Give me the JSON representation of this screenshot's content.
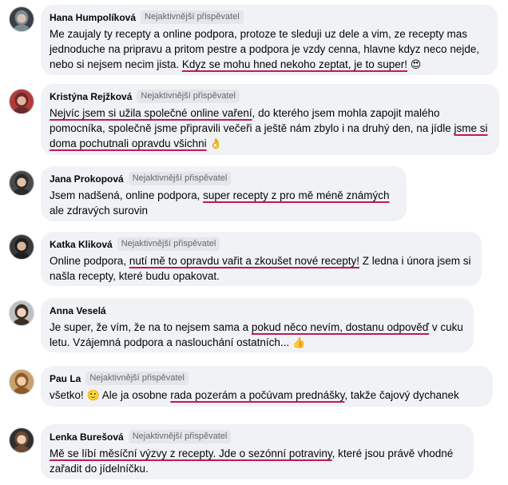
{
  "comments": [
    {
      "name": "Hana Humpolíková",
      "badge": "Nejaktivnější přispěvatel",
      "avatar_icon": "user-photo-avatar",
      "parts": [
        {
          "text": "Me zaujaly ty recepty a online podpora, protoze te sleduji uz dele a vim, ze recepty mas jednoduche na pripravu a pritom pestre a podpora je vzdy cenna, hlavne kdyz neco nejde, nebo si nejsem necim jista. "
        },
        {
          "text": "Kdyz se mohu hned nekoho zeptat, je to super!",
          "hl": true
        },
        {
          "text": " "
        },
        {
          "text": "😍",
          "emoji": true
        }
      ]
    },
    {
      "name": "Kristýna Rejžková",
      "badge": "Nejaktivnější přispěvatel",
      "avatar_icon": "user-photo-avatar",
      "parts": [
        {
          "text": "Nejvíc jsem si užila společné online vaření",
          "hl": true
        },
        {
          "text": ", do kterého jsem mohla zapojit malého pomocníka, společně jsme připravili večeři a ještě nám zbylo i na druhý den, na jídle "
        },
        {
          "text": "jsme si doma pochutnali opravdu všichni",
          "hl": true
        },
        {
          "text": " "
        },
        {
          "text": "👌",
          "emoji": true
        }
      ]
    },
    {
      "name": "Jana Prokopová",
      "badge": "Nejaktivnější přispěvatel",
      "avatar_icon": "user-photo-avatar",
      "parts": [
        {
          "text": "Jsem nadšená, online podpora, "
        },
        {
          "text": "super recepty z pro mě méně známých",
          "hl": true
        },
        {
          "text": " ale zdravých surovin"
        }
      ]
    },
    {
      "name": "Katka Kliková",
      "badge": "Nejaktivnější přispěvatel",
      "avatar_icon": "user-photo-avatar",
      "parts": [
        {
          "text": "Online podpora, "
        },
        {
          "text": "nutí mě to opravdu vařit a zkoušet nové recepty!",
          "hl": true
        },
        {
          "text": " Z ledna i února jsem si našla recepty, které budu opakovat."
        }
      ]
    },
    {
      "name": "Anna Veselá",
      "badge": "",
      "avatar_icon": "user-photo-avatar",
      "parts": [
        {
          "text": "Je super, že vím, že na to nejsem sama a "
        },
        {
          "text": "pokud něco nevím, dostanu odpověď",
          "hl": true
        },
        {
          "text": " v cuku letu. Vzájemná podpora a naslouchání ostatních... "
        },
        {
          "text": "👍",
          "emoji": true
        }
      ]
    },
    {
      "name": "Pau La",
      "badge": "Nejaktivnější přispěvatel",
      "avatar_icon": "user-photo-avatar",
      "parts": [
        {
          "text": "všetko! "
        },
        {
          "text": "🙂",
          "emoji": true
        },
        {
          "text": " Ale ja osobne "
        },
        {
          "text": "rada pozerám a počúvam prednášky",
          "hl": true
        },
        {
          "text": ", takže čajový dychanek"
        }
      ]
    },
    {
      "name": "Lenka Burešová",
      "badge": "Nejaktivnější přispěvatel",
      "avatar_icon": "user-photo-avatar",
      "parts": [
        {
          "text": "Mě se líbí měsíční výzvy z recepty. Jde o sezónní potraviny",
          "hl": true
        },
        {
          "text": ", které jsou právě vhodné zařadit do jídelníčku."
        }
      ]
    }
  ],
  "colors": {
    "bubble_bg": "#f0f2f5",
    "badge_bg": "#e4e6eb",
    "badge_text": "#65676b",
    "highlight_underline": "#c2185b"
  }
}
